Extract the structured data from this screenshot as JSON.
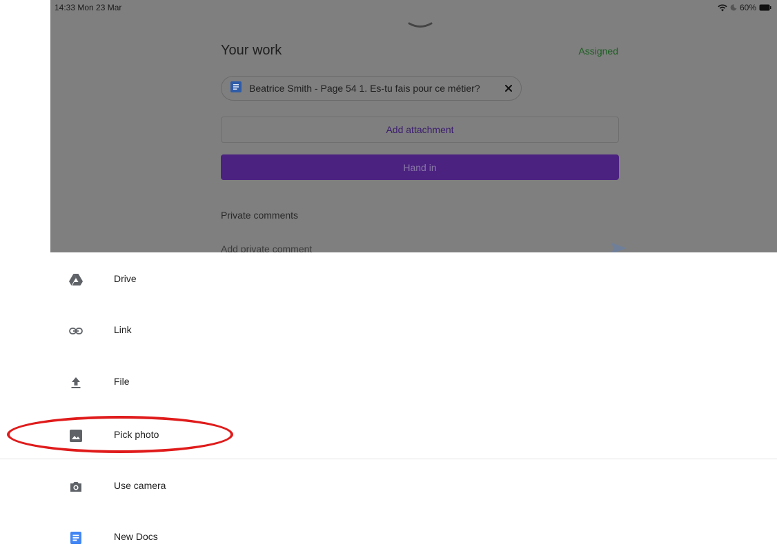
{
  "status_bar": {
    "time": "14:33  Mon 23 Mar",
    "battery": "60%"
  },
  "work": {
    "title": "Your work",
    "status": "Assigned",
    "attachment_name": "Beatrice Smith - Page 54 1. Es-tu fais pour ce métier?",
    "add_attachment_label": "Add attachment",
    "hand_in_label": "Hand in",
    "private_comments_label": "Private comments",
    "comment_placeholder": "Add private comment"
  },
  "menu": {
    "items": [
      {
        "label": "Drive",
        "icon": "drive-icon"
      },
      {
        "label": "Link",
        "icon": "link-icon"
      },
      {
        "label": "File",
        "icon": "upload-icon"
      },
      {
        "label": "Pick photo",
        "icon": "photo-icon"
      },
      {
        "label": "Use camera",
        "icon": "camera-icon"
      },
      {
        "label": "New Docs",
        "icon": "docs-icon"
      }
    ]
  },
  "colors": {
    "overlay": "#7f7f7f",
    "accent_purple": "#4b2280",
    "docs_blue": "#4285f4",
    "highlight_red": "#e01b1b"
  }
}
